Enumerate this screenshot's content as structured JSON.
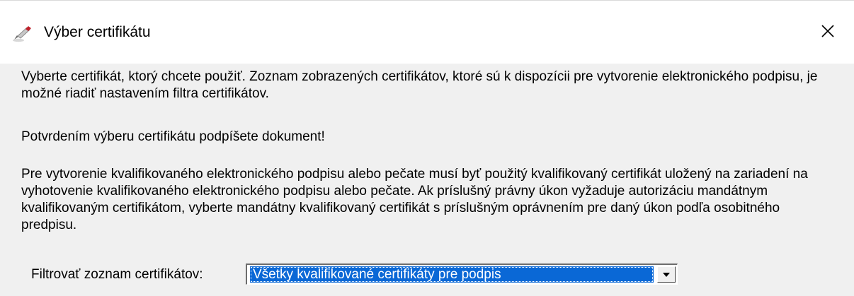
{
  "dialog": {
    "title": "Výber certifikátu",
    "app_icon": "pen-icon",
    "close_icon": "close-icon"
  },
  "content": {
    "paragraph1": "Vyberte certifikát, ktorý chcete použiť. Zoznam zobrazených certifikátov, ktoré sú k dispozícii pre vytvorenie elektronického podpisu, je možné riadiť nastavením filtra certifikátov.",
    "paragraph2": "Potvrdením výberu certifikátu podpíšete dokument!",
    "paragraph3": "Pre vytvorenie kvalifikovaného elektronického podpisu alebo pečate musí byť použitý kvalifikovaný certifikát uložený na zariadení na vyhotovenie kvalifikovaného elektronického podpisu alebo pečate. Ak príslušný právny úkon vyžaduje autorizáciu mandátnym kvalifikovaným certifikátom, vyberte mandátny kvalifikovaný certifikát s príslušným oprávnením pre daný úkon podľa osobitného predpisu."
  },
  "filter": {
    "label": "Filtrovať zoznam certifikátov:",
    "selected": "Všetky kvalifikované certifikáty pre podpis",
    "dropdown_icon": "chevron-down-icon"
  },
  "colors": {
    "selection": "#0a68d6",
    "dialog_background": "#f0f0f0",
    "titlebar_background": "#ffffff"
  }
}
